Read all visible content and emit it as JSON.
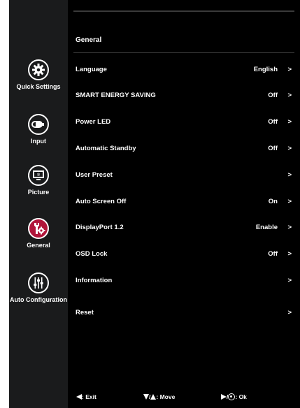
{
  "sidebar": {
    "items": [
      {
        "label": "Quick Settings",
        "icon": "gear-icon",
        "active": false
      },
      {
        "label": "Input",
        "icon": "input-plug-icon",
        "active": false
      },
      {
        "label": "Picture",
        "icon": "monitor-icon",
        "active": false
      },
      {
        "label": "General",
        "icon": "wrench-gear-icon",
        "active": true
      },
      {
        "label": "Auto Configuration",
        "icon": "sliders-icon",
        "active": false
      }
    ]
  },
  "main": {
    "section_title": "General",
    "rows": [
      {
        "label": "Language",
        "value": "English",
        "arrow": ">"
      },
      {
        "label": "SMART ENERGY SAVING",
        "value": "Off",
        "arrow": ">"
      },
      {
        "label": "Power LED",
        "value": "Off",
        "arrow": ">"
      },
      {
        "label": "Automatic Standby",
        "value": "Off",
        "arrow": ">"
      },
      {
        "label": "User Preset",
        "value": "",
        "arrow": ">"
      },
      {
        "label": "Auto Screen Off",
        "value": "On",
        "arrow": ">"
      },
      {
        "label": "DisplayPort 1.2",
        "value": "Enable",
        "arrow": ">"
      },
      {
        "label": "OSD Lock",
        "value": "Off",
        "arrow": ">"
      },
      {
        "label": "Information",
        "value": "",
        "arrow": ">"
      },
      {
        "label": "Reset",
        "value": "",
        "arrow": ">"
      }
    ]
  },
  "footer": {
    "exit_label": ": Exit",
    "move_slash": "/",
    "move_label": ": Move",
    "ok_slash": "/",
    "ok_label": ": Ok"
  },
  "colors": {
    "sidebar_bg": "#1a1b1c",
    "main_bg": "#000000",
    "active_icon_bg": "#b0153a",
    "text": "#ffffff"
  }
}
